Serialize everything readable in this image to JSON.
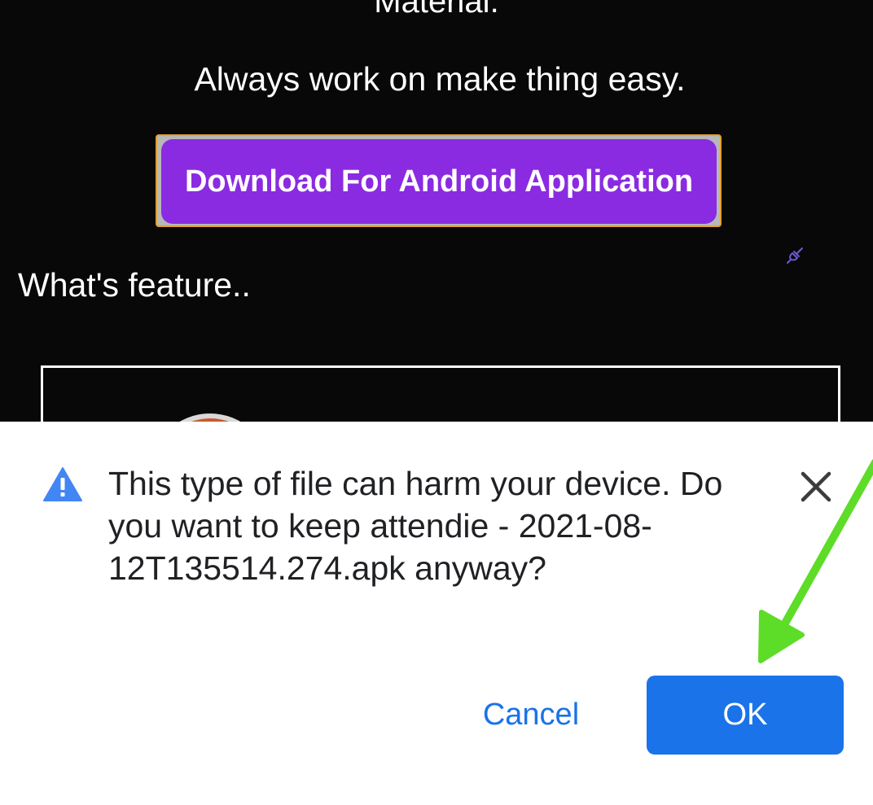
{
  "webpage": {
    "top_line": "Material.",
    "tagline": "Always work on make thing easy.",
    "download_button_label": "Download For Android Application",
    "feature_heading": "What's feature.."
  },
  "dialog": {
    "message": "This type of file can harm your device. Do you want to keep attendie - 2021-08-12T135514.274.apk anyway?",
    "cancel_label": "Cancel",
    "ok_label": "OK"
  },
  "icons": {
    "warning": "warning-triangle-icon",
    "close": "close-icon",
    "plug": "plug-disconnected-icon",
    "annotation": "green-arrow-annotation"
  },
  "colors": {
    "page_background": "#080808",
    "download_button": "#8a2be2",
    "download_frame": "#e0a030",
    "dialog_accent": "#1a73e8",
    "warning_icon": "#4285f4",
    "annotation_arrow": "#5ddc28"
  }
}
